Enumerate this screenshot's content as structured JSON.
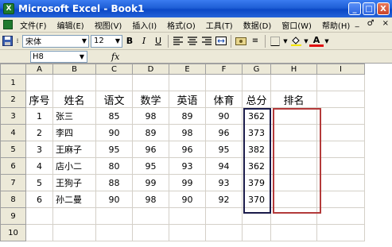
{
  "window": {
    "title": "Microsoft Excel - Book1",
    "minimize": "_",
    "maximize": "□",
    "close": "X"
  },
  "menu": {
    "items": [
      "文件(F)",
      "编辑(E)",
      "视图(V)",
      "插入(I)",
      "格式(O)",
      "工具(T)",
      "数据(D)",
      "窗口(W)",
      "帮助(H)"
    ],
    "right": [
      "_",
      "♂",
      "×"
    ]
  },
  "toolbar": {
    "font_name": "宋体",
    "font_size": "12",
    "bold": "B",
    "italic": "I",
    "underline": "U",
    "font_color": "A"
  },
  "formula": {
    "name_box": "H8",
    "fx": "fx",
    "value": ""
  },
  "sheet": {
    "columns": [
      "A",
      "B",
      "C",
      "D",
      "E",
      "F",
      "G",
      "H",
      "I"
    ],
    "rows": [
      {
        "n": "1",
        "cells": [
          "",
          "",
          "",
          "",
          "",
          "",
          "",
          "",
          ""
        ]
      },
      {
        "n": "2",
        "cells": [
          "序号",
          "姓名",
          "语文",
          "数学",
          "英语",
          "体育",
          "总分",
          "排名",
          ""
        ]
      },
      {
        "n": "3",
        "cells": [
          "1",
          "张三",
          "85",
          "98",
          "89",
          "90",
          "362",
          "",
          ""
        ]
      },
      {
        "n": "4",
        "cells": [
          "2",
          "李四",
          "90",
          "89",
          "98",
          "96",
          "373",
          "",
          ""
        ]
      },
      {
        "n": "5",
        "cells": [
          "3",
          "王麻子",
          "95",
          "96",
          "96",
          "95",
          "382",
          "",
          ""
        ]
      },
      {
        "n": "6",
        "cells": [
          "4",
          "店小二",
          "80",
          "95",
          "93",
          "94",
          "362",
          "",
          ""
        ]
      },
      {
        "n": "7",
        "cells": [
          "5",
          "王狗子",
          "88",
          "99",
          "99",
          "93",
          "379",
          "",
          ""
        ]
      },
      {
        "n": "8",
        "cells": [
          "6",
          "孙二曼",
          "90",
          "98",
          "90",
          "92",
          "370",
          "",
          ""
        ]
      },
      {
        "n": "9",
        "cells": [
          "",
          "",
          "",
          "",
          "",
          "",
          "",
          "",
          ""
        ]
      },
      {
        "n": "10",
        "cells": [
          "",
          "",
          "",
          "",
          "",
          "",
          "",
          "",
          ""
        ]
      }
    ]
  }
}
